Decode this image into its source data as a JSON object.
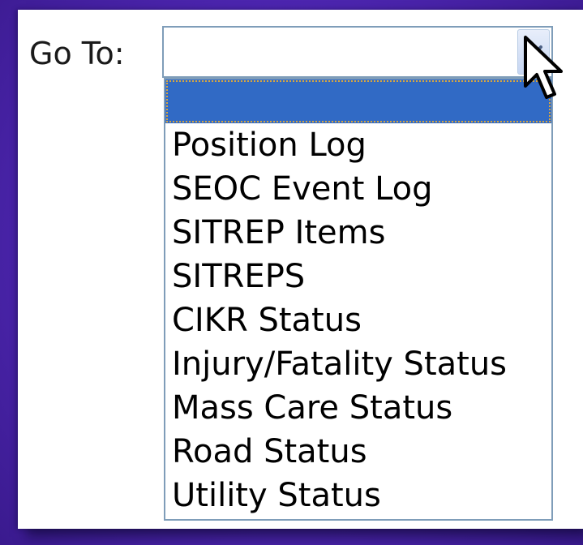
{
  "goto": {
    "label": "Go To:",
    "selected_value": ""
  },
  "dropdown": {
    "options": [
      "",
      "Position Log",
      "SEOC Event Log",
      "SITREP Items",
      "SITREPS",
      "CIKR Status",
      "Injury/Fatality Status",
      "Mass Care Status",
      "Road Status",
      "Utility Status"
    ],
    "highlighted_index": 0
  },
  "icons": {
    "arrow": "chevron-down-icon",
    "cursor": "mouse-pointer-icon"
  },
  "colors": {
    "background": "#4d26b0",
    "highlight": "#316ac5",
    "border": "#7f9db9",
    "focus_outline": "#d8a640"
  }
}
